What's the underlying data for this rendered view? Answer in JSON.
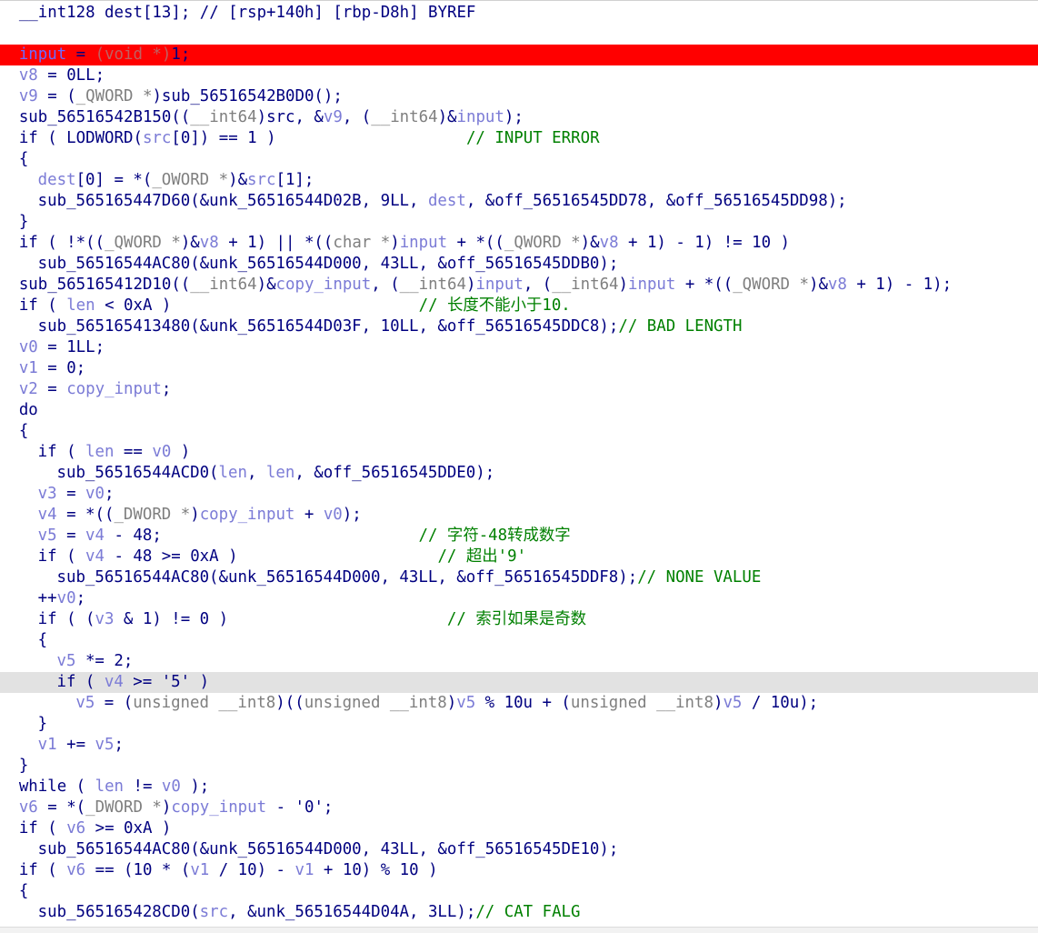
{
  "colors": {
    "default": "#000080",
    "variable": "#7b7bd6",
    "type": "#7f7f7f",
    "comment": "#008000",
    "error_line_bg": "#ff0000",
    "hover_line_bg": "#e2e2e2"
  },
  "code_view": {
    "lines": [
      {
        "indent": 2,
        "tokens": [
          {
            "c": "def",
            "t": "__int128 dest[13]; // [rsp+140h] [rbp-D8h] BYREF"
          }
        ]
      },
      {
        "indent": 0,
        "tokens": [
          {
            "c": "def",
            "t": ""
          }
        ]
      },
      {
        "indent": 2,
        "state": "error",
        "tokens": [
          {
            "c": "err-hi",
            "t": "input"
          },
          {
            "c": "def",
            "t": " = "
          },
          {
            "c": "err-lo",
            "t": "(void *)"
          },
          {
            "c": "def",
            "t": "1;"
          }
        ]
      },
      {
        "indent": 2,
        "tokens": [
          {
            "c": "var",
            "t": "v8"
          },
          {
            "c": "def",
            "t": " = 0LL;"
          }
        ]
      },
      {
        "indent": 2,
        "tokens": [
          {
            "c": "var",
            "t": "v9"
          },
          {
            "c": "def",
            "t": " = ("
          },
          {
            "c": "type",
            "t": "_QWORD *"
          },
          {
            "c": "def",
            "t": ")sub_56516542B0D0();"
          }
        ]
      },
      {
        "indent": 2,
        "tokens": [
          {
            "c": "def",
            "t": "sub_56516542B150(("
          },
          {
            "c": "type",
            "t": "__int64"
          },
          {
            "c": "def",
            "t": ")src, &"
          },
          {
            "c": "var",
            "t": "v9"
          },
          {
            "c": "def",
            "t": ", ("
          },
          {
            "c": "type",
            "t": "__int64"
          },
          {
            "c": "def",
            "t": ")&"
          },
          {
            "c": "var",
            "t": "input"
          },
          {
            "c": "def",
            "t": ");"
          }
        ]
      },
      {
        "indent": 2,
        "tokens": [
          {
            "c": "def",
            "t": "if ( LODWORD("
          },
          {
            "c": "var",
            "t": "src"
          },
          {
            "c": "def",
            "t": "[0]) == 1 )                    "
          },
          {
            "c": "com",
            "t": "// INPUT ERROR"
          }
        ]
      },
      {
        "indent": 2,
        "tokens": [
          {
            "c": "def",
            "t": "{"
          }
        ]
      },
      {
        "indent": 4,
        "tokens": [
          {
            "c": "var",
            "t": "dest"
          },
          {
            "c": "def",
            "t": "[0] = *("
          },
          {
            "c": "type",
            "t": "_OWORD *"
          },
          {
            "c": "def",
            "t": ")&"
          },
          {
            "c": "var",
            "t": "src"
          },
          {
            "c": "def",
            "t": "[1];"
          }
        ]
      },
      {
        "indent": 4,
        "tokens": [
          {
            "c": "def",
            "t": "sub_565165447D60(&unk_56516544D02B, 9LL, "
          },
          {
            "c": "var",
            "t": "dest"
          },
          {
            "c": "def",
            "t": ", &off_56516545DD78, &off_56516545DD98);"
          }
        ]
      },
      {
        "indent": 2,
        "tokens": [
          {
            "c": "def",
            "t": "}"
          }
        ]
      },
      {
        "indent": 2,
        "tokens": [
          {
            "c": "def",
            "t": "if ( !*(("
          },
          {
            "c": "type",
            "t": "_QWORD *"
          },
          {
            "c": "def",
            "t": ")&"
          },
          {
            "c": "var",
            "t": "v8"
          },
          {
            "c": "def",
            "t": " + 1) || *(("
          },
          {
            "c": "type",
            "t": "char *"
          },
          {
            "c": "def",
            "t": ")"
          },
          {
            "c": "var",
            "t": "input"
          },
          {
            "c": "def",
            "t": " + *(("
          },
          {
            "c": "type",
            "t": "_QWORD *"
          },
          {
            "c": "def",
            "t": ")&"
          },
          {
            "c": "var",
            "t": "v8"
          },
          {
            "c": "def",
            "t": " + 1) - 1) != 10 )"
          }
        ]
      },
      {
        "indent": 4,
        "tokens": [
          {
            "c": "def",
            "t": "sub_56516544AC80(&unk_56516544D000, 43LL, &off_56516545DDB0);"
          }
        ]
      },
      {
        "indent": 2,
        "tokens": [
          {
            "c": "def",
            "t": "sub_565165412D10(("
          },
          {
            "c": "type",
            "t": "__int64"
          },
          {
            "c": "def",
            "t": ")&"
          },
          {
            "c": "var",
            "t": "copy_input"
          },
          {
            "c": "def",
            "t": ", ("
          },
          {
            "c": "type",
            "t": "__int64"
          },
          {
            "c": "def",
            "t": ")"
          },
          {
            "c": "var",
            "t": "input"
          },
          {
            "c": "def",
            "t": ", ("
          },
          {
            "c": "type",
            "t": "__int64"
          },
          {
            "c": "def",
            "t": ")"
          },
          {
            "c": "var",
            "t": "input"
          },
          {
            "c": "def",
            "t": " + *(("
          },
          {
            "c": "type",
            "t": "_QWORD *"
          },
          {
            "c": "def",
            "t": ")&"
          },
          {
            "c": "var",
            "t": "v8"
          },
          {
            "c": "def",
            "t": " + 1) - 1);"
          }
        ]
      },
      {
        "indent": 2,
        "tokens": [
          {
            "c": "def",
            "t": "if ( "
          },
          {
            "c": "var",
            "t": "len"
          },
          {
            "c": "def",
            "t": " < 0xA )                          "
          },
          {
            "c": "com",
            "t": "// 长度不能小于10."
          }
        ]
      },
      {
        "indent": 4,
        "tokens": [
          {
            "c": "def",
            "t": "sub_565165413480(&unk_56516544D03F, 10LL, &off_56516545DDC8);"
          },
          {
            "c": "com",
            "t": "// BAD LENGTH"
          }
        ]
      },
      {
        "indent": 2,
        "tokens": [
          {
            "c": "var",
            "t": "v0"
          },
          {
            "c": "def",
            "t": " = 1LL;"
          }
        ]
      },
      {
        "indent": 2,
        "tokens": [
          {
            "c": "var",
            "t": "v1"
          },
          {
            "c": "def",
            "t": " = 0;"
          }
        ]
      },
      {
        "indent": 2,
        "tokens": [
          {
            "c": "var",
            "t": "v2"
          },
          {
            "c": "def",
            "t": " = "
          },
          {
            "c": "var",
            "t": "copy_input"
          },
          {
            "c": "def",
            "t": ";"
          }
        ]
      },
      {
        "indent": 2,
        "tokens": [
          {
            "c": "def",
            "t": "do"
          }
        ]
      },
      {
        "indent": 2,
        "tokens": [
          {
            "c": "def",
            "t": "{"
          }
        ]
      },
      {
        "indent": 4,
        "tokens": [
          {
            "c": "def",
            "t": "if ( "
          },
          {
            "c": "var",
            "t": "len"
          },
          {
            "c": "def",
            "t": " == "
          },
          {
            "c": "var",
            "t": "v0"
          },
          {
            "c": "def",
            "t": " )"
          }
        ]
      },
      {
        "indent": 6,
        "tokens": [
          {
            "c": "def",
            "t": "sub_56516544ACD0("
          },
          {
            "c": "var",
            "t": "len"
          },
          {
            "c": "def",
            "t": ", "
          },
          {
            "c": "var",
            "t": "len"
          },
          {
            "c": "def",
            "t": ", &off_56516545DDE0);"
          }
        ]
      },
      {
        "indent": 4,
        "tokens": [
          {
            "c": "var",
            "t": "v3"
          },
          {
            "c": "def",
            "t": " = "
          },
          {
            "c": "var",
            "t": "v0"
          },
          {
            "c": "def",
            "t": ";"
          }
        ]
      },
      {
        "indent": 4,
        "tokens": [
          {
            "c": "var",
            "t": "v4"
          },
          {
            "c": "def",
            "t": " = *(("
          },
          {
            "c": "type",
            "t": "_DWORD *"
          },
          {
            "c": "def",
            "t": ")"
          },
          {
            "c": "var",
            "t": "copy_input"
          },
          {
            "c": "def",
            "t": " + "
          },
          {
            "c": "var",
            "t": "v0"
          },
          {
            "c": "def",
            "t": ");"
          }
        ]
      },
      {
        "indent": 4,
        "tokens": [
          {
            "c": "var",
            "t": "v5"
          },
          {
            "c": "def",
            "t": " = "
          },
          {
            "c": "var",
            "t": "v4"
          },
          {
            "c": "def",
            "t": " - 48;                           "
          },
          {
            "c": "com",
            "t": "// 字符-48转成数字"
          }
        ]
      },
      {
        "indent": 4,
        "tokens": [
          {
            "c": "def",
            "t": "if ( "
          },
          {
            "c": "var",
            "t": "v4"
          },
          {
            "c": "def",
            "t": " - 48 >= 0xA )                     "
          },
          {
            "c": "com",
            "t": "// 超出'9'"
          }
        ]
      },
      {
        "indent": 6,
        "tokens": [
          {
            "c": "def",
            "t": "sub_56516544AC80(&unk_56516544D000, 43LL, &off_56516545DDF8);"
          },
          {
            "c": "com",
            "t": "// NONE VALUE"
          }
        ]
      },
      {
        "indent": 4,
        "tokens": [
          {
            "c": "def",
            "t": "++"
          },
          {
            "c": "var",
            "t": "v0"
          },
          {
            "c": "def",
            "t": ";"
          }
        ]
      },
      {
        "indent": 4,
        "tokens": [
          {
            "c": "def",
            "t": "if ( ("
          },
          {
            "c": "var",
            "t": "v3"
          },
          {
            "c": "def",
            "t": " & 1) != 0 )                       "
          },
          {
            "c": "com",
            "t": "// 索引如果是奇数"
          }
        ]
      },
      {
        "indent": 4,
        "tokens": [
          {
            "c": "def",
            "t": "{"
          }
        ]
      },
      {
        "indent": 6,
        "tokens": [
          {
            "c": "var",
            "t": "v5"
          },
          {
            "c": "def",
            "t": " *= 2;"
          }
        ]
      },
      {
        "indent": 6,
        "state": "hover",
        "tokens": [
          {
            "c": "def",
            "t": "if ( "
          },
          {
            "c": "var",
            "t": "v4"
          },
          {
            "c": "def",
            "t": " >= '5' )"
          }
        ]
      },
      {
        "indent": 8,
        "tokens": [
          {
            "c": "var",
            "t": "v5"
          },
          {
            "c": "def",
            "t": " = ("
          },
          {
            "c": "type",
            "t": "unsigned __int8"
          },
          {
            "c": "def",
            "t": ")(("
          },
          {
            "c": "type",
            "t": "unsigned __int8"
          },
          {
            "c": "def",
            "t": ")"
          },
          {
            "c": "var",
            "t": "v5"
          },
          {
            "c": "def",
            "t": " % 10u + ("
          },
          {
            "c": "type",
            "t": "unsigned __int8"
          },
          {
            "c": "def",
            "t": ")"
          },
          {
            "c": "var",
            "t": "v5"
          },
          {
            "c": "def",
            "t": " / 10u);"
          }
        ]
      },
      {
        "indent": 4,
        "tokens": [
          {
            "c": "def",
            "t": "}"
          }
        ]
      },
      {
        "indent": 4,
        "tokens": [
          {
            "c": "var",
            "t": "v1"
          },
          {
            "c": "def",
            "t": " += "
          },
          {
            "c": "var",
            "t": "v5"
          },
          {
            "c": "def",
            "t": ";"
          }
        ]
      },
      {
        "indent": 2,
        "tokens": [
          {
            "c": "def",
            "t": "}"
          }
        ]
      },
      {
        "indent": 2,
        "tokens": [
          {
            "c": "def",
            "t": "while ( "
          },
          {
            "c": "var",
            "t": "len"
          },
          {
            "c": "def",
            "t": " != "
          },
          {
            "c": "var",
            "t": "v0"
          },
          {
            "c": "def",
            "t": " );"
          }
        ]
      },
      {
        "indent": 2,
        "tokens": [
          {
            "c": "var",
            "t": "v6"
          },
          {
            "c": "def",
            "t": " = *("
          },
          {
            "c": "type",
            "t": "_DWORD *"
          },
          {
            "c": "def",
            "t": ")"
          },
          {
            "c": "var",
            "t": "copy_input"
          },
          {
            "c": "def",
            "t": " - '0';"
          }
        ]
      },
      {
        "indent": 2,
        "tokens": [
          {
            "c": "def",
            "t": "if ( "
          },
          {
            "c": "var",
            "t": "v6"
          },
          {
            "c": "def",
            "t": " >= 0xA )"
          }
        ]
      },
      {
        "indent": 4,
        "tokens": [
          {
            "c": "def",
            "t": "sub_56516544AC80(&unk_56516544D000, 43LL, &off_56516545DE10);"
          }
        ]
      },
      {
        "indent": 2,
        "tokens": [
          {
            "c": "def",
            "t": "if ( "
          },
          {
            "c": "var",
            "t": "v6"
          },
          {
            "c": "def",
            "t": " == (10 * ("
          },
          {
            "c": "var",
            "t": "v1"
          },
          {
            "c": "def",
            "t": " / 10) - "
          },
          {
            "c": "var",
            "t": "v1"
          },
          {
            "c": "def",
            "t": " + 10) % 10 )"
          }
        ]
      },
      {
        "indent": 2,
        "tokens": [
          {
            "c": "def",
            "t": "{"
          }
        ]
      },
      {
        "indent": 4,
        "tokens": [
          {
            "c": "def",
            "t": "sub_565165428CD0("
          },
          {
            "c": "var",
            "t": "src"
          },
          {
            "c": "def",
            "t": ", &unk_56516544D04A, 3LL);"
          },
          {
            "c": "com",
            "t": "// CAT FALG"
          }
        ]
      }
    ]
  }
}
